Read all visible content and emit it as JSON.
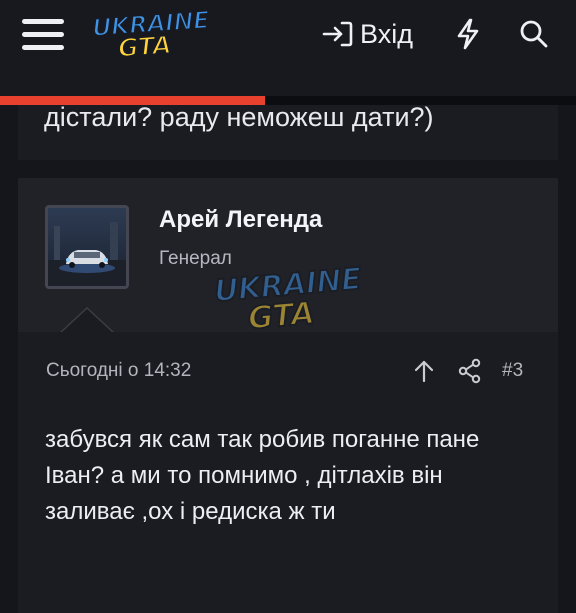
{
  "header": {
    "logo": {
      "line1": "UKRAINE",
      "line2": "GTA"
    },
    "login_label": "Вхід",
    "reading_progress_percent": 46,
    "colors": {
      "accent": "#e8412d",
      "logo_blue": "#3f93e6",
      "logo_yellow": "#ffd43b"
    },
    "icons": [
      "menu-icon",
      "login-icon",
      "bolt-icon",
      "search-icon"
    ]
  },
  "previous_post": {
    "text": "дістали? раду неможеш дати?)"
  },
  "post": {
    "author": {
      "name": "Арей Легенда",
      "title": "Генерал"
    },
    "date": "Сьогодні о 14:32",
    "number": "#3",
    "body": "забувся як сам так робив поганне пане Іван? а ми то помнимо , дітлахів він заливає ,ох і редиска ж ти",
    "icons": [
      "arrow-up-icon",
      "share-icon"
    ]
  },
  "watermark": {
    "line1": "UKRAINE",
    "line2": "GTA"
  }
}
